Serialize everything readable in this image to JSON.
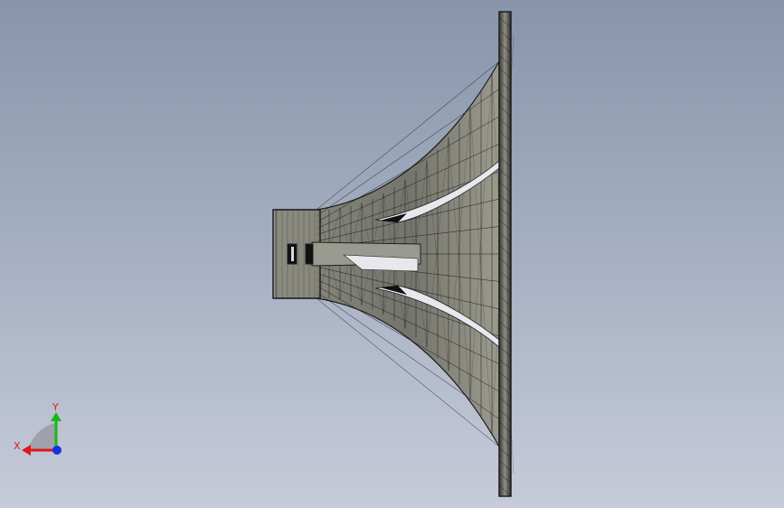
{
  "viewport": {
    "background_top": "#8794aa",
    "background_bottom": "#c6cbd9",
    "model_fill": "#6f6f68",
    "model_fill_light": "#9a9a8e",
    "mesh_line": "#1e1e1e",
    "slot_fill": "#e6e8ec"
  },
  "triad": {
    "x_label": "X",
    "y_label": "Y",
    "x_color": "#e01818",
    "y_color": "#18b818",
    "z_color": "#1830e0",
    "label_color": "#d02020"
  }
}
